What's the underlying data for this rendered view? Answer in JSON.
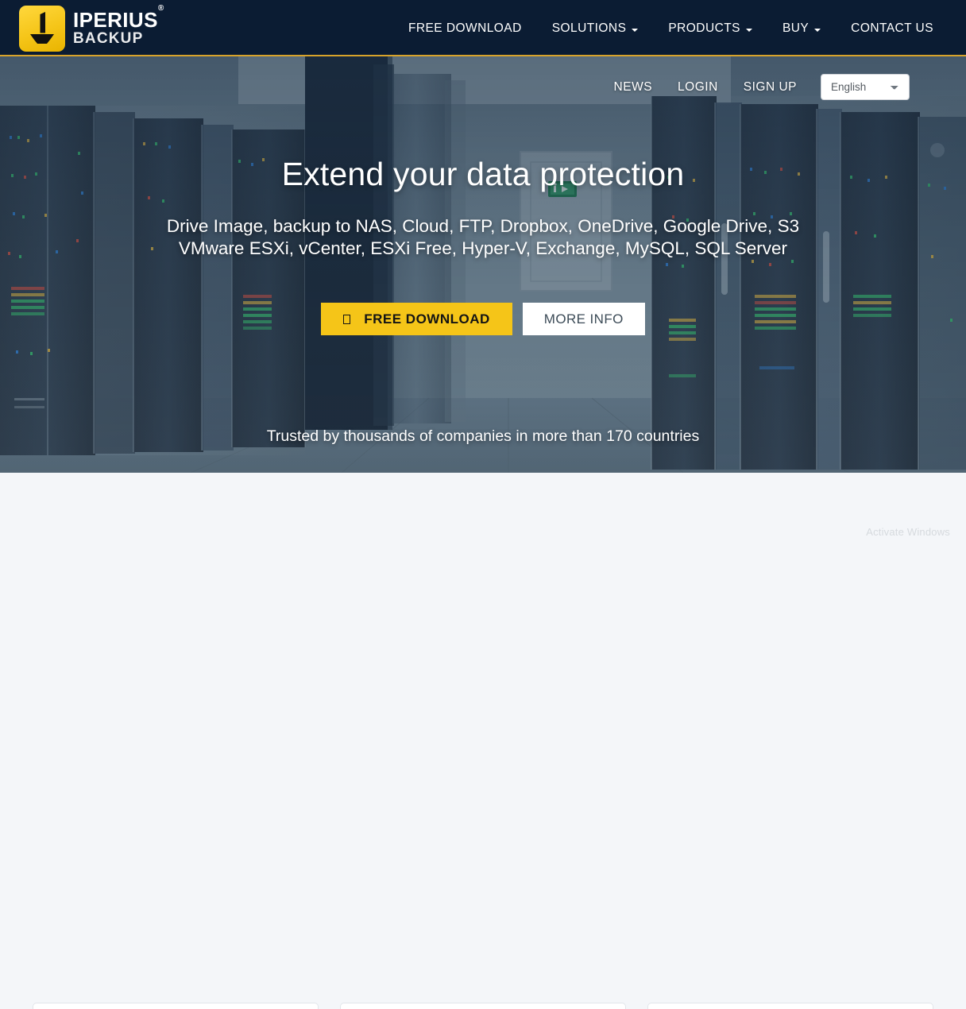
{
  "brand": {
    "name": "IPERIUS",
    "registered": "®",
    "subname": "BACKUP",
    "logo_icon": "download-anchor-icon",
    "logo_bg": "#f5c518"
  },
  "header": {
    "bg": "#0b1c33",
    "accent_line": "#d8a32a",
    "nav": [
      {
        "label": "FREE DOWNLOAD",
        "caret": false
      },
      {
        "label": "SOLUTIONS",
        "caret": true
      },
      {
        "label": "PRODUCTS",
        "caret": true
      },
      {
        "label": "BUY",
        "caret": true
      },
      {
        "label": "CONTACT US",
        "caret": false
      }
    ]
  },
  "hero": {
    "background": "data-center server room photo",
    "topnav": [
      {
        "label": "NEWS"
      },
      {
        "label": "LOGIN"
      },
      {
        "label": "SIGN UP"
      }
    ],
    "language": {
      "selected": "English",
      "options": [
        "English"
      ]
    },
    "title": "Extend your data protection",
    "subtitle_line1": "Drive Image, backup to NAS, Cloud, FTP, Dropbox, OneDrive, Google Drive, S3",
    "subtitle_line2": "VMware ESXi, vCenter, ESXi Free, Hyper-V, Exchange, MySQL, SQL Server",
    "primary_button": {
      "label": "FREE DOWNLOAD",
      "icon": "download-icon",
      "bg": "#f5c518",
      "fg": "#141414"
    },
    "secondary_button": {
      "label": "MORE INFO",
      "bg": "#ffffff",
      "fg": "#3c4b57"
    },
    "trust_text": "Trusted by thousands of companies in more than 170 countries"
  },
  "below": {
    "bg": "#f4f6f9",
    "cards": [
      {
        "id": "card-1"
      },
      {
        "id": "card-2"
      },
      {
        "id": "card-3"
      }
    ],
    "watermark": "Activate Windows"
  }
}
